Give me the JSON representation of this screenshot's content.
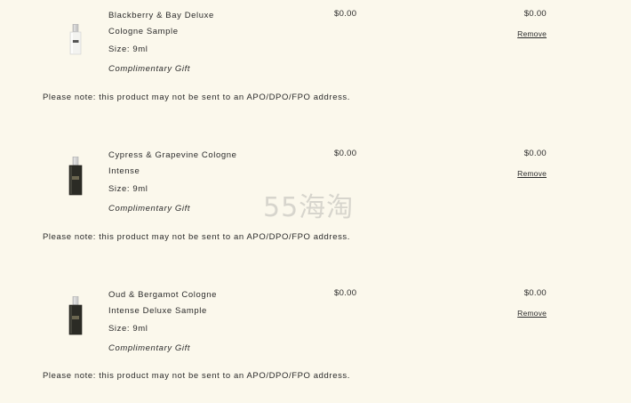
{
  "colors": {
    "background": "#fbf8ec",
    "text": "#2a2a2a",
    "watermark": "rgba(150,150,150,0.35)"
  },
  "items": [
    {
      "name": "Blackberry & Bay Deluxe Cologne Sample",
      "size": "Size: 9ml",
      "gift": "Complimentary Gift",
      "price": "$0.00",
      "total": "$0.00",
      "remove_label": "Remove",
      "bottle": "clear",
      "note": "Please note: this product may not be sent to an APO/DPO/FPO address."
    },
    {
      "name": "Cypress & Grapevine Cologne Intense",
      "size": "Size: 9ml",
      "gift": "Complimentary Gift",
      "price": "$0.00",
      "total": "$0.00",
      "remove_label": "Remove",
      "bottle": "dark",
      "note": "Please note: this product may not be sent to an APO/DPO/FPO address."
    },
    {
      "name": "Oud & Bergamot Cologne Intense Deluxe Sample",
      "size": "Size: 9ml",
      "gift": "Complimentary Gift",
      "price": "$0.00",
      "total": "$0.00",
      "remove_label": "Remove",
      "bottle": "dark",
      "note": "Please note: this product may not be sent to an APO/DPO/FPO address."
    }
  ],
  "watermark": "55海淘"
}
